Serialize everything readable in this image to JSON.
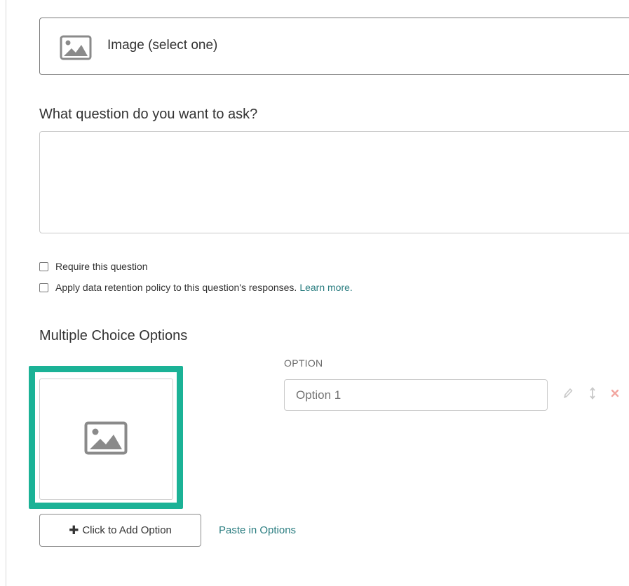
{
  "question_type": {
    "icon": "image-icon",
    "label": "Image (select one)"
  },
  "question": {
    "label": "What question do you want to ask?",
    "value": "",
    "placeholder": ""
  },
  "settings": {
    "require": {
      "label": "Require this question",
      "checked": false
    },
    "retention": {
      "label": "Apply data retention policy to this question's responses.",
      "link": "Learn more.",
      "checked": false
    }
  },
  "options_section": {
    "heading": "Multiple Choice Options",
    "column_header": "OPTION",
    "options": [
      {
        "image_icon": "image-placeholder-icon",
        "placeholder": "Option 1",
        "value": "",
        "actions": [
          "pencil-icon",
          "move-arrows-icon",
          "delete-x-icon"
        ]
      }
    ],
    "add_button": {
      "icon": "plus-icon",
      "label": "Click to Add Option"
    },
    "paste_link": "Paste in Options"
  },
  "colors": {
    "highlight": "#1bb296",
    "link": "#2a7d80",
    "delete": "#f2a6a0",
    "muted_icon": "#c9c9c9"
  }
}
